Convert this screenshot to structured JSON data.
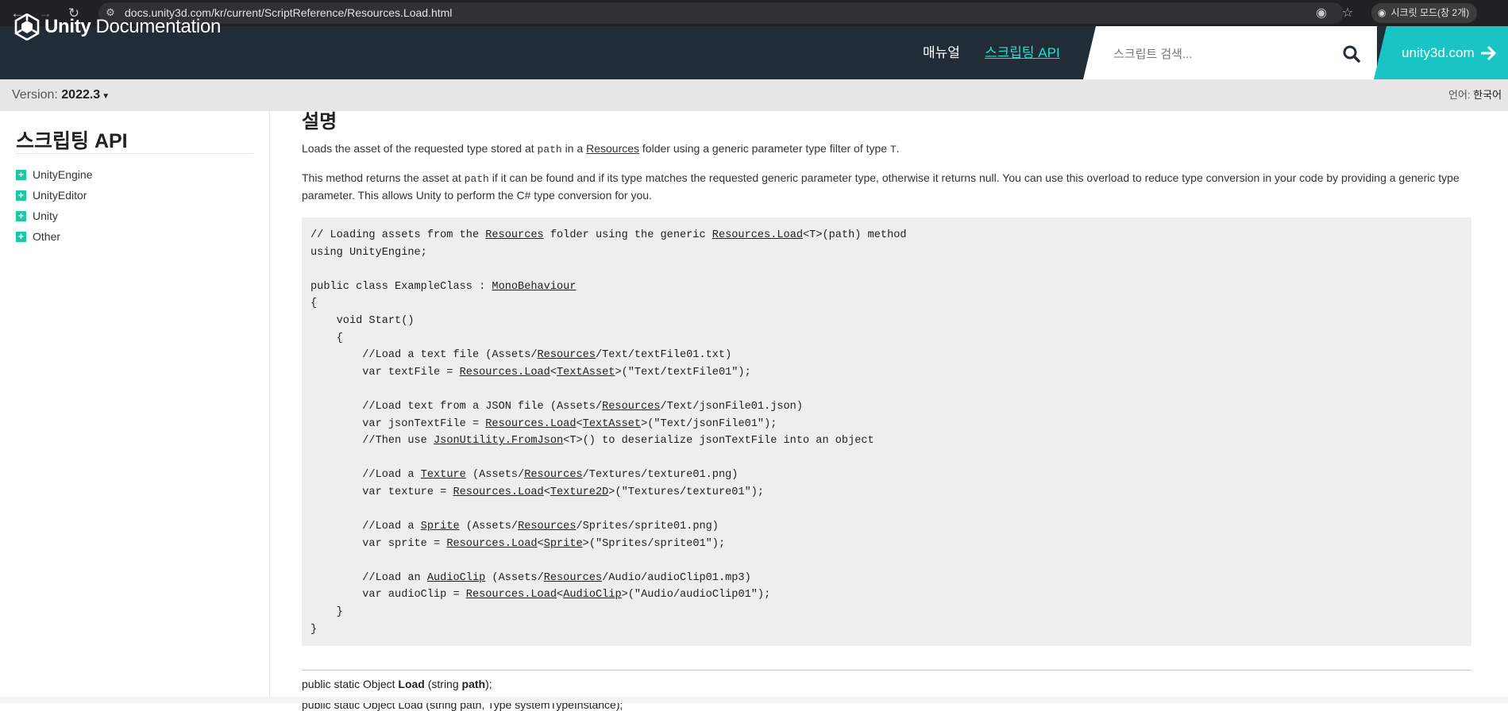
{
  "browser": {
    "url": "docs.unity3d.com/kr/current/ScriptReference/Resources.Load.html",
    "incognito_label": "시크릿 모드(창 2개)"
  },
  "header": {
    "logo_bold": "Unity",
    "logo_text": "Documentation",
    "nav_manual": "매뉴얼",
    "nav_script_api": "스크립팅 API",
    "search_placeholder": "스크립트 검색...",
    "site_link": "unity3d.com",
    "accent_color": "#19c4c4",
    "bg_color": "#222c37"
  },
  "version_bar": {
    "version_label": "Version:",
    "version_value": "2022.3",
    "language_label": "언어:",
    "language_value": "한국어"
  },
  "sidebar": {
    "title": "스크립팅 API",
    "items": [
      {
        "label": "UnityEngine"
      },
      {
        "label": "UnityEditor"
      },
      {
        "label": "Unity"
      },
      {
        "label": "Other"
      }
    ]
  },
  "content": {
    "section_title": "설명",
    "para1": {
      "a": "Loads the asset of the requested type stored at ",
      "code1": "path",
      "b": " in a ",
      "link": "Resources",
      "c": " folder using a generic parameter type filter of type ",
      "code2": "T",
      "d": "."
    },
    "para2": {
      "a": "This method returns the asset at ",
      "code": "path",
      "b": " if it can be found and if its type matches the requested generic parameter type, otherwise it returns null. You can use this overload to reduce type conversion in your code by providing a generic type parameter. This allows Unity to perform the C# type conversion for you."
    },
    "code_lines": [
      [
        "// Loading assets from the ",
        {
          "u": "Resources"
        },
        " folder using the generic ",
        {
          "u": "Resources.Load"
        },
        "<T>(path) method"
      ],
      [
        "using UnityEngine;"
      ],
      [
        ""
      ],
      [
        "public class ExampleClass : ",
        {
          "u": "MonoBehaviour"
        }
      ],
      [
        "{"
      ],
      [
        "    void Start()"
      ],
      [
        "    {"
      ],
      [
        "        //Load a text file (Assets/",
        {
          "u": "Resources"
        },
        "/Text/textFile01.txt)"
      ],
      [
        "        var textFile = ",
        {
          "u": "Resources.Load"
        },
        "<",
        {
          "u": "TextAsset"
        },
        ">(\"Text/textFile01\");"
      ],
      [
        ""
      ],
      [
        "        //Load text from a JSON file (Assets/",
        {
          "u": "Resources"
        },
        "/Text/jsonFile01.json)"
      ],
      [
        "        var jsonTextFile = ",
        {
          "u": "Resources.Load"
        },
        "<",
        {
          "u": "TextAsset"
        },
        ">(\"Text/jsonFile01\");"
      ],
      [
        "        //Then use ",
        {
          "u": "JsonUtility.FromJson"
        },
        "<T>() to deserialize jsonTextFile into an object"
      ],
      [
        ""
      ],
      [
        "        //Load a ",
        {
          "u": "Texture"
        },
        " (Assets/",
        {
          "u": "Resources"
        },
        "/Textures/texture01.png)"
      ],
      [
        "        var texture = ",
        {
          "u": "Resources.Load"
        },
        "<",
        {
          "u": "Texture2D"
        },
        ">(\"Textures/texture01\");"
      ],
      [
        ""
      ],
      [
        "        //Load a ",
        {
          "u": "Sprite"
        },
        " (Assets/",
        {
          "u": "Resources"
        },
        "/Sprites/sprite01.png)"
      ],
      [
        "        var sprite = ",
        {
          "u": "Resources.Load"
        },
        "<",
        {
          "u": "Sprite"
        },
        ">(\"Sprites/sprite01\");"
      ],
      [
        ""
      ],
      [
        "        //Load an ",
        {
          "u": "AudioClip"
        },
        " (Assets/",
        {
          "u": "Resources"
        },
        "/Audio/audioClip01.mp3)"
      ],
      [
        "        var audioClip = ",
        {
          "u": "Resources.Load"
        },
        "<",
        {
          "u": "AudioClip"
        },
        ">(\"Audio/audioClip01\");"
      ],
      [
        "    }"
      ],
      [
        "}"
      ]
    ],
    "signature": {
      "prefix": "public static Object ",
      "name": "Load",
      "open": " (string ",
      "param": "path",
      "close": ");"
    },
    "signature2_partial": "public static Object Load (string path, Type systemTypeInstance);"
  }
}
